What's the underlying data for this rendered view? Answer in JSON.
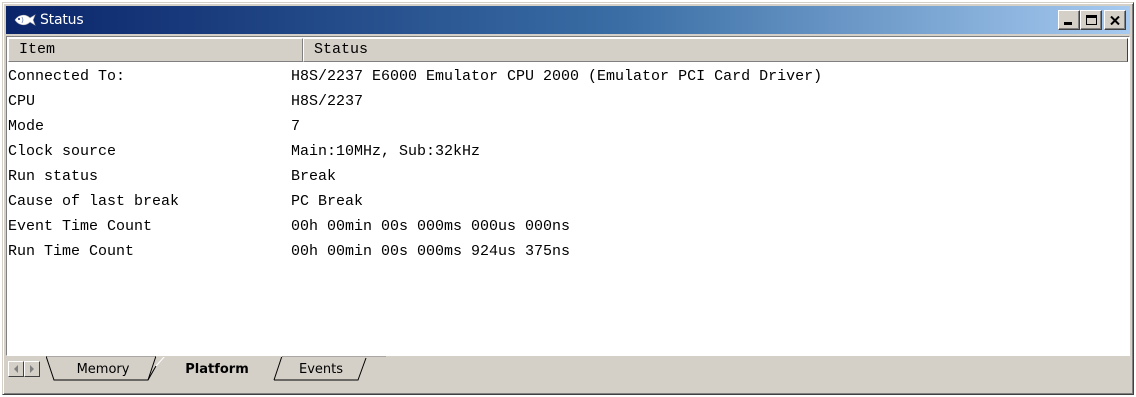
{
  "window": {
    "title": "Status"
  },
  "table": {
    "columns": [
      "Item",
      "Status"
    ],
    "rows": [
      {
        "item": "Connected To:",
        "status": "H8S/2237 E6000 Emulator CPU 2000 (Emulator PCI Card Driver)"
      },
      {
        "item": "CPU",
        "status": "H8S/2237"
      },
      {
        "item": "Mode",
        "status": "7"
      },
      {
        "item": "Clock source",
        "status": "Main:10MHz, Sub:32kHz"
      },
      {
        "item": "Run status",
        "status": "Break"
      },
      {
        "item": "Cause of last break",
        "status": "PC Break"
      },
      {
        "item": "Event Time Count",
        "status": "00h 00min 00s 000ms 000us 000ns"
      },
      {
        "item": "Run Time Count",
        "status": "00h 00min 00s 000ms 924us 375ns"
      }
    ]
  },
  "tabs": [
    {
      "label": "Memory",
      "active": false
    },
    {
      "label": "Platform",
      "active": true
    },
    {
      "label": "Events",
      "active": false
    }
  ],
  "icons": {
    "app": "fish-icon",
    "minimize": "minimize-icon",
    "maximize": "maximize-icon",
    "close": "close-icon",
    "tab_left": "scroll-left-icon",
    "tab_right": "scroll-right-icon"
  },
  "colors": {
    "titlebar_start": "#0a246a",
    "titlebar_end": "#a6caf0",
    "face": "#d4d0c8"
  }
}
